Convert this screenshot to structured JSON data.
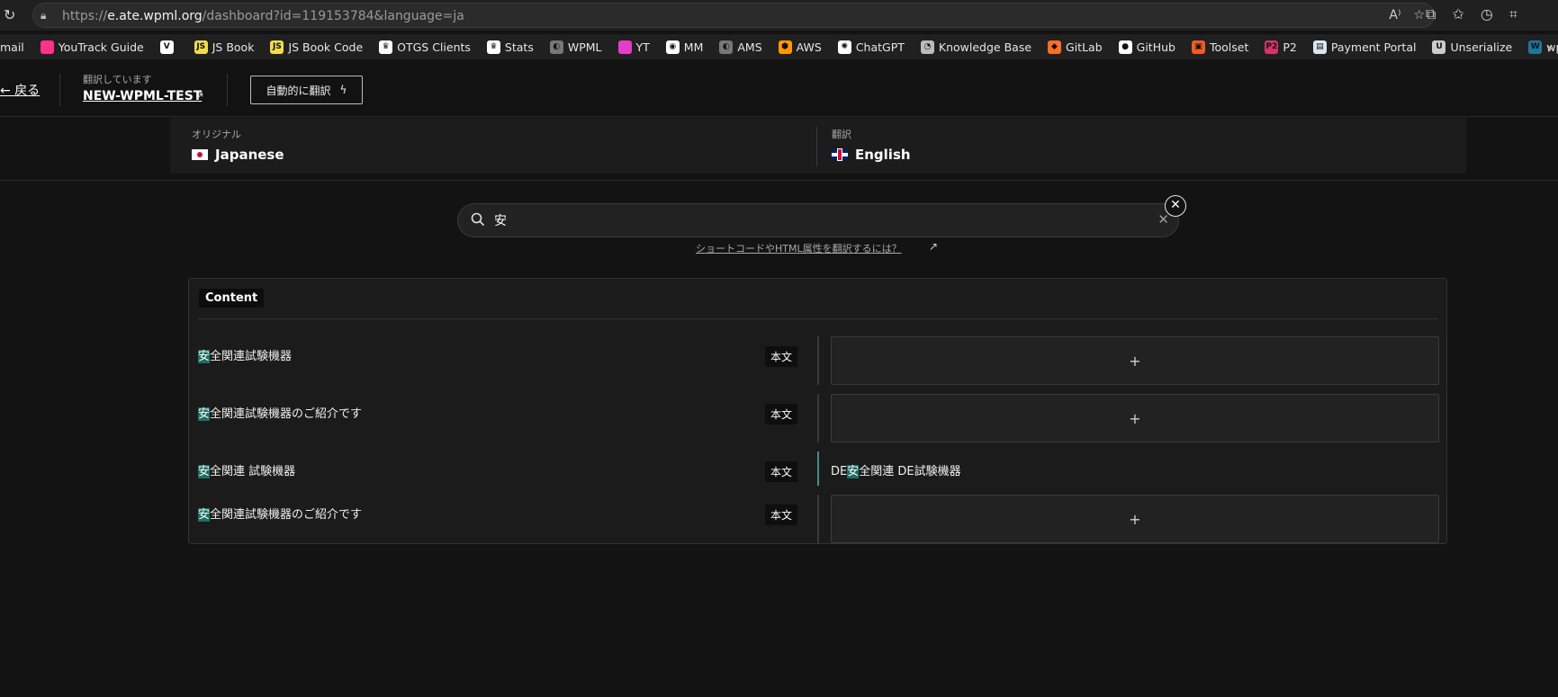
{
  "browser": {
    "url_prefix": "https://",
    "url_host": "e.ate.wpml.org",
    "url_path": "/dashboard?id=119153784&language=ja",
    "bookmarks": [
      {
        "label": "mail",
        "icon": "mail-icon",
        "color": ""
      },
      {
        "label": "YouTrack Guide",
        "icon": "youtrack-icon",
        "color": "#ff318c"
      },
      {
        "label": "",
        "icon": "vue-icon",
        "color": "#ffffff"
      },
      {
        "label": "JS Book",
        "icon": "js-icon",
        "color": "#f0db4f"
      },
      {
        "label": "JS Book Code",
        "icon": "js-icon",
        "color": "#f0db4f"
      },
      {
        "label": "OTGS Clients",
        "icon": "otgs-icon",
        "color": "#ffffff"
      },
      {
        "label": "Stats",
        "icon": "otgs-icon",
        "color": "#ffffff"
      },
      {
        "label": "WPML",
        "icon": "wpml-icon",
        "color": "#777777"
      },
      {
        "label": "YT",
        "icon": "youtrack-icon",
        "color": "#e33ec8"
      },
      {
        "label": "MM",
        "icon": "mm-icon",
        "color": "#ffffff"
      },
      {
        "label": "AMS",
        "icon": "wpml-icon",
        "color": "#777777"
      },
      {
        "label": "AWS",
        "icon": "aws-icon",
        "color": "#ff9900"
      },
      {
        "label": "ChatGPT",
        "icon": "chatgpt-icon",
        "color": "#ffffff"
      },
      {
        "label": "Knowledge Base",
        "icon": "kb-icon",
        "color": "#bbbbbb"
      },
      {
        "label": "GitLab",
        "icon": "gitlab-icon",
        "color": "#fc6d26"
      },
      {
        "label": "GitHub",
        "icon": "github-icon",
        "color": "#ffffff"
      },
      {
        "label": "Toolset",
        "icon": "toolset-icon",
        "color": "#f15a24"
      },
      {
        "label": "P2",
        "icon": "p2-icon",
        "color": "#d6336c"
      },
      {
        "label": "Payment Portal",
        "icon": "doc-icon",
        "color": "#d9e6f2"
      },
      {
        "label": "Unserialize",
        "icon": "unserialize-icon",
        "color": "#cccccc"
      },
      {
        "label": "wpml-comp",
        "icon": "wordpress-icon",
        "color": "#21759b"
      }
    ]
  },
  "header": {
    "back_label": "戻る",
    "translating_label": "翻訳しています",
    "project_name": "NEW-WPML-TEST",
    "auto_translate_label": "自動的に翻訳"
  },
  "languages": {
    "source_label": "オリジナル",
    "source_name": "Japanese",
    "target_label": "翻訳",
    "target_name": "English"
  },
  "search": {
    "value": "安",
    "help_text": "ショートコードやHTML属性を翻訳するには？"
  },
  "content": {
    "section_tag": "Content",
    "rows": [
      {
        "src_hl": "安",
        "src_rest": "全関連試験機器",
        "type": "本文",
        "target": "",
        "add": "+"
      },
      {
        "src_hl": "安",
        "src_rest": "全関連試験機器のご紹介です",
        "type": "本文",
        "target": "",
        "add": "+"
      },
      {
        "src_hl": "安",
        "src_rest": "全関連 試験機器",
        "type": "本文",
        "target_pre": "DE",
        "target_hl": "安",
        "target_post": "全関連 DE試験機器",
        "add": ""
      },
      {
        "src_hl": "安",
        "src_rest": "全関連試験機器のご紹介です",
        "type": "本文",
        "target": "",
        "add": "+"
      }
    ]
  },
  "colors": {
    "accent_highlight": "#1f6e64",
    "filled_indicator": "#3e8e88",
    "background": "#131313"
  }
}
